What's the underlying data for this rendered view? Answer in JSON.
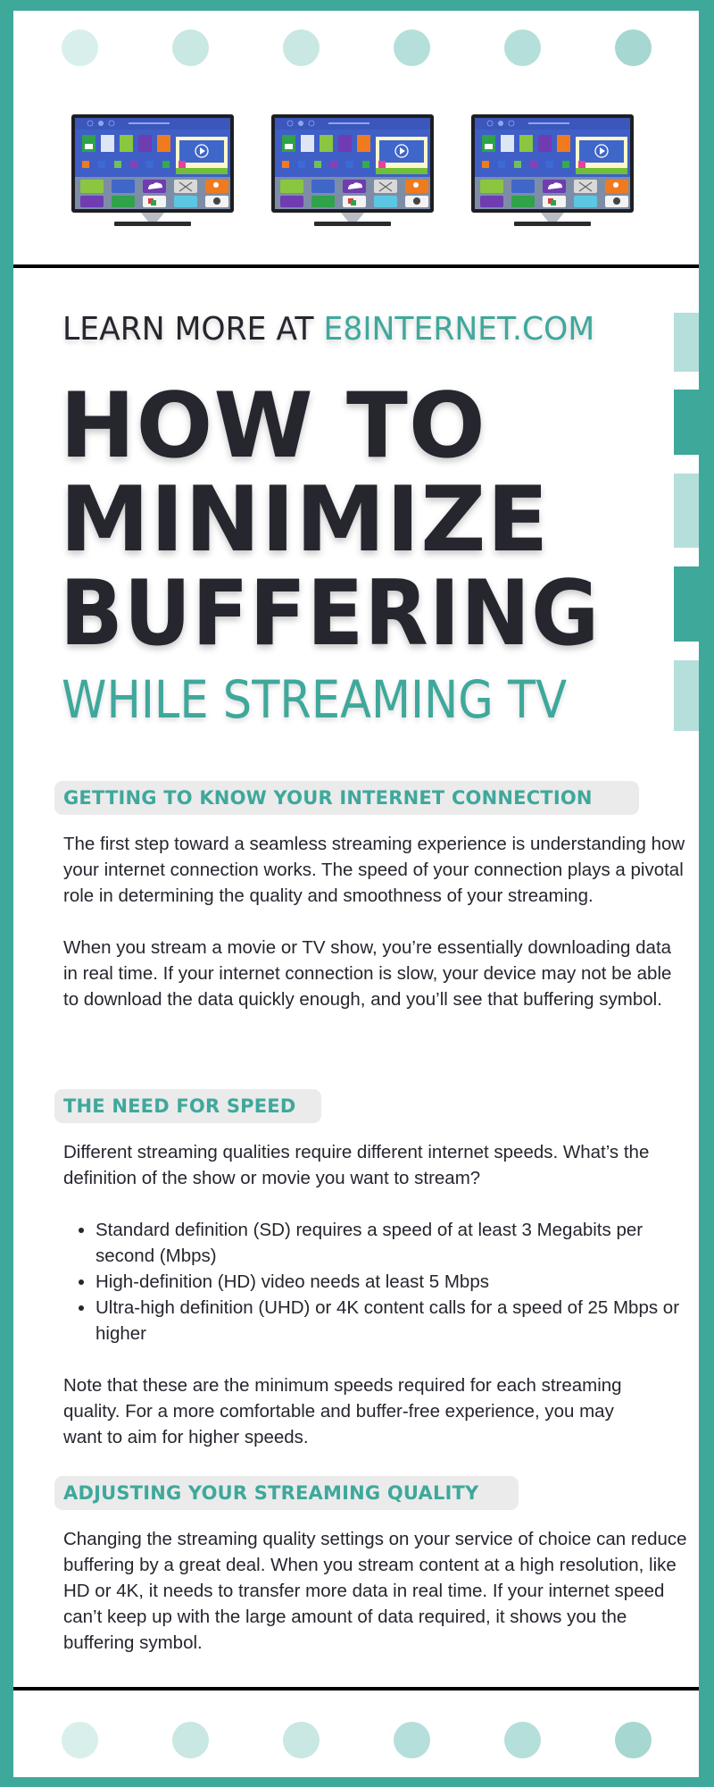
{
  "colors": {
    "brand_teal": "#3ea89b",
    "teal_light": "#b5dfda",
    "dark_text": "#25262e",
    "pill_bg": "#ebebeb",
    "dot_shades": [
      "#d9efec",
      "#c9e7e3",
      "#c9e7e3",
      "#b5dfda",
      "#b5dfda",
      "#a6d7d1"
    ]
  },
  "header": {
    "tv_icons": [
      "smart-tv-icon",
      "smart-tv-icon",
      "smart-tv-icon"
    ]
  },
  "learn_more": {
    "prefix": "LEARN MORE AT ",
    "url": "E8INTERNET.COM"
  },
  "title": {
    "line1": "HOW TO",
    "line2": "MINIMIZE",
    "line3": "BUFFERING",
    "subtitle": "WHILE STREAMING TV"
  },
  "sections": [
    {
      "heading": "GETTING TO KNOW YOUR INTERNET CONNECTION",
      "paragraphs": [
        "The first step toward a seamless streaming experience is understanding how your internet connection works. The speed of your connection plays a pivotal role in determining the quality and smoothness of your streaming.",
        "When you stream a movie or TV show, you’re essentially downloading data in real time. If your internet connection is slow, your device may not be able to download the data quickly enough, and you’ll see that buffering symbol."
      ]
    },
    {
      "heading": "THE NEED FOR SPEED",
      "intro": "Different streaming qualities require different internet speeds. What’s the definition of the show or movie you want to stream?",
      "bullets": [
        "Standard definition (SD) requires a speed of at least 3 Megabits per second (Mbps)",
        "High-definition (HD) video needs at least 5 Mbps",
        "Ultra-high definition (UHD) or 4K content calls for a speed of 25 Mbps or higher"
      ],
      "note": "Note that these are the minimum speeds required for each streaming quality. For a more comfortable and buffer-free experience, you may want to aim for higher speeds."
    },
    {
      "heading": "ADJUSTING YOUR STREAMING QUALITY",
      "paragraphs": [
        "Changing the streaming quality settings on your service of choice can reduce buffering by a great deal. When you stream content at a high resolution, like HD or 4K, it needs to transfer more data in real time. If your internet speed can’t keep up with the large amount of data required, it shows you the buffering symbol."
      ]
    }
  ]
}
